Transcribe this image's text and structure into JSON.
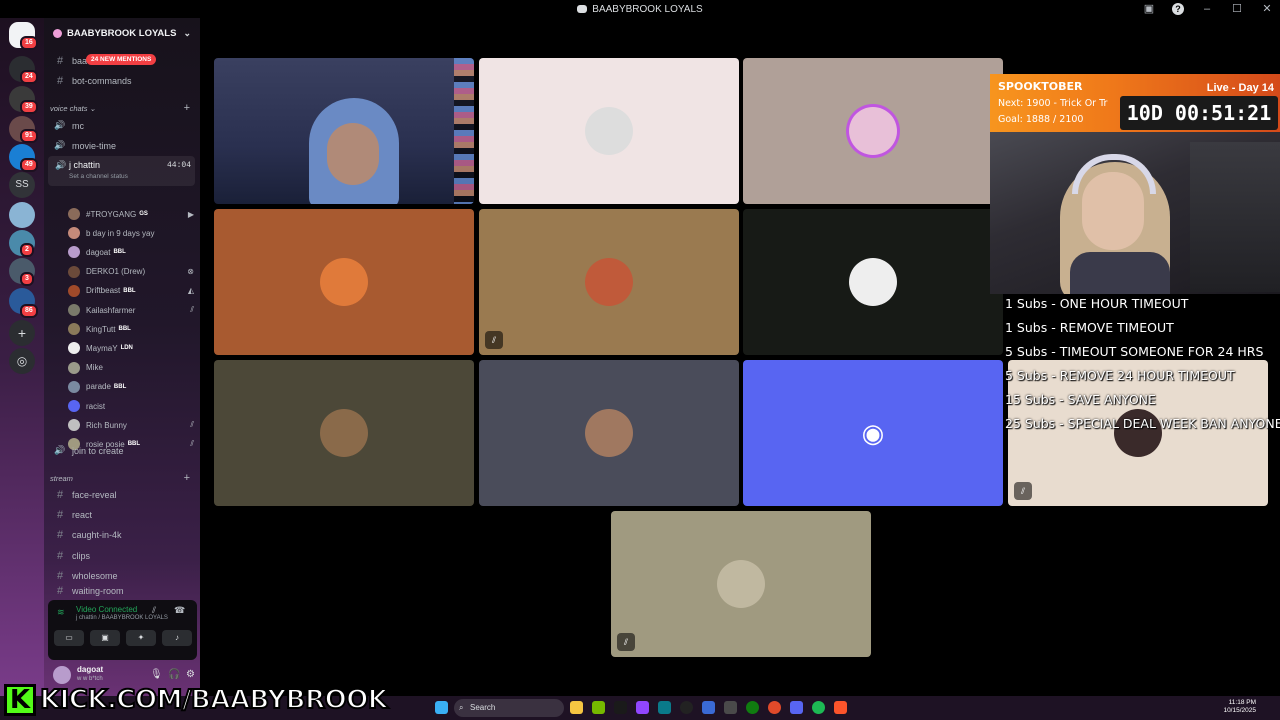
{
  "window": {
    "title": "BAABYBROOK LOYALS"
  },
  "rail": {
    "badges": [
      "16",
      "24",
      "39",
      "91",
      "49",
      "2",
      "3",
      "86"
    ],
    "ss_label": "SS"
  },
  "server": {
    "name": "BAABYBROOK LOYALS"
  },
  "channels": {
    "top": [
      {
        "name": "baa"
      },
      {
        "name": "bot-commands"
      }
    ],
    "mention_pill": "24 NEW MENTIONS",
    "voice_category": "voice chats",
    "voice": [
      {
        "name": "mc"
      },
      {
        "name": "movie-time"
      }
    ],
    "active": {
      "name": "j chattin",
      "status": "Set a channel status",
      "time": "44:04"
    },
    "join": "join to create",
    "stream_category": "stream",
    "stream": [
      {
        "name": "face-reveal"
      },
      {
        "name": "react"
      },
      {
        "name": "caught-in-4k"
      },
      {
        "name": "clips"
      },
      {
        "name": "wholesome"
      },
      {
        "name": "waiting-room"
      }
    ]
  },
  "members": [
    {
      "name": "#TROYGANG",
      "tag": "GS",
      "icon": "camera-icon",
      "color": "#8a6b5a"
    },
    {
      "name": "b day in 9 days yay",
      "tag": "",
      "icon": "",
      "color": "#c48a7a"
    },
    {
      "name": "dagoat",
      "tag": "BBL",
      "icon": "",
      "color": "#b89ccc"
    },
    {
      "name": "DERKO1 (Drew)",
      "tag": "",
      "icon": "xbox-icon",
      "color": "#6b4a3a"
    },
    {
      "name": "Driftbeast",
      "tag": "BBL",
      "icon": "playstation-icon",
      "color": "#a04a2a"
    },
    {
      "name": "Kailashfarmer",
      "tag": "",
      "icon": "mute-icon",
      "color": "#7a7a6a"
    },
    {
      "name": "KingTutt",
      "tag": "BBL",
      "icon": "",
      "color": "#8a7a5a"
    },
    {
      "name": "MaymaY",
      "tag": "LDN",
      "icon": "",
      "color": "#eeeeee"
    },
    {
      "name": "Mike",
      "tag": "",
      "icon": "",
      "color": "#9a9a8a"
    },
    {
      "name": "parade",
      "tag": "BBL",
      "icon": "",
      "color": "#7a8aa0"
    },
    {
      "name": "racist",
      "tag": "",
      "icon": "",
      "color": "#5865f2"
    },
    {
      "name": "Rich Bunny",
      "tag": "",
      "icon": "mute-icon",
      "color": "#c0c0c0"
    },
    {
      "name": "rosie posie",
      "tag": "BBL",
      "icon": "mute-icon",
      "color": "#a09a80"
    }
  ],
  "voice_panel": {
    "status": "Video Connected",
    "location": "j chattin / BAABYBROOK LOYALS"
  },
  "user": {
    "name": "dagoat",
    "status": "w w b*tch"
  },
  "tiles": [
    {
      "id": "t1",
      "bg": "#2a3050"
    },
    {
      "id": "t2",
      "bg": "#f0e4e4"
    },
    {
      "id": "t3",
      "bg": "#b0a098"
    },
    {
      "id": "t4",
      "bg": "#a85a30"
    },
    {
      "id": "t5",
      "bg": "#9a7a50"
    },
    {
      "id": "t6",
      "bg": "#171a16"
    },
    {
      "id": "t7",
      "bg": "#4c4838"
    },
    {
      "id": "t8",
      "bg": "#4a4c5a"
    },
    {
      "id": "t9",
      "bg": "#5865f2"
    },
    {
      "id": "t10",
      "bg": "#e8dccf"
    },
    {
      "id": "t11",
      "bg": "#a09a80"
    }
  ],
  "overlay": {
    "title": "SPOOKTOBER",
    "next": "Next: 1900 - Trick Or Tr",
    "goal": "Goal: 1888 / 2100",
    "live": "Live - Day 14",
    "timer": "10D 00:51:21"
  },
  "sub_goals": [
    "1 Subs - ONE HOUR TIMEOUT",
    "1 Subs - REMOVE TIMEOUT",
    "5 Subs - TIMEOUT SOMEONE FOR 24 HRS",
    "5 Subs - REMOVE 24 HOUR TIMEOUT",
    "15 Subs - SAVE ANYONE",
    "25 Subs - SPECIAL DEAL WEEK BAN ANYONE"
  ],
  "kick": {
    "k": "K",
    "url": "KICK.COM/BAABYBROOK"
  },
  "taskbar": {
    "search_placeholder": "Search",
    "time": "11:18 PM",
    "date": "10/15/2025"
  }
}
